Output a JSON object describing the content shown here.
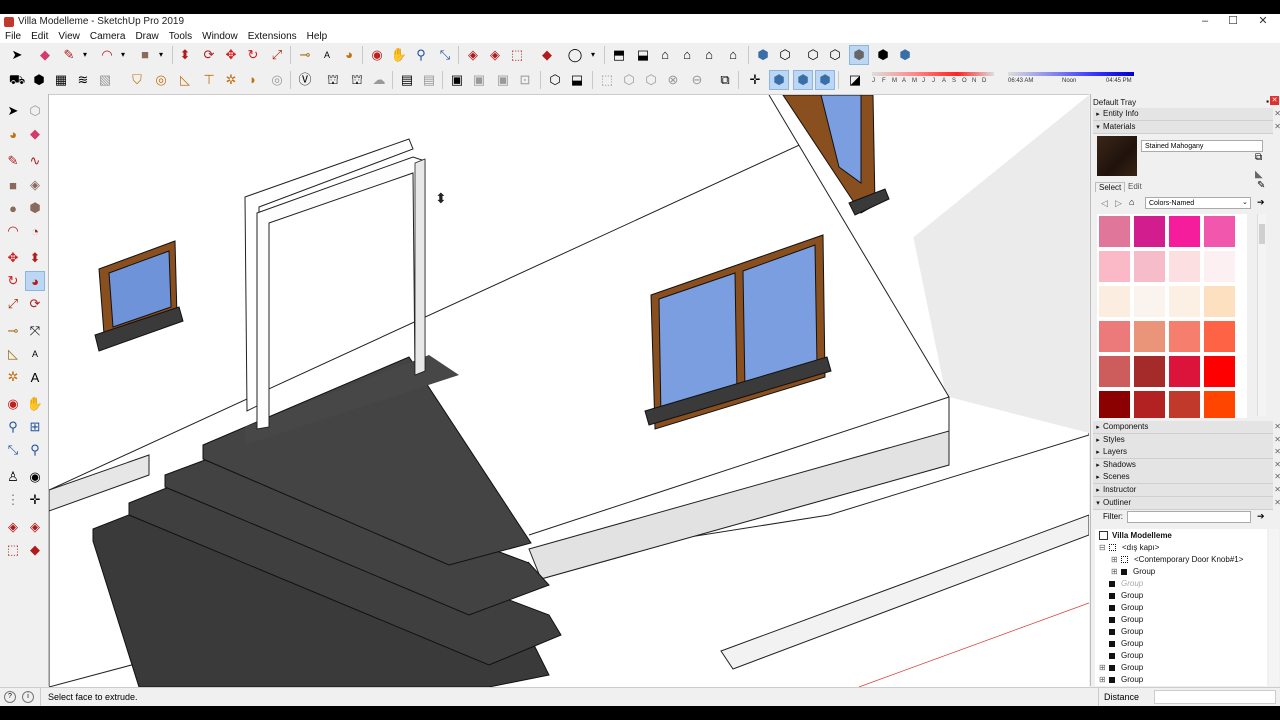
{
  "window": {
    "title": "Villa Modelleme - SketchUp Pro 2019",
    "controls": [
      "–",
      "☐",
      "✕"
    ]
  },
  "menu": [
    "File",
    "Edit",
    "View",
    "Camera",
    "Draw",
    "Tools",
    "Window",
    "Extensions",
    "Help"
  ],
  "shadow_settings": {
    "months": [
      "J",
      "F",
      "M",
      "A",
      "M",
      "J",
      "J",
      "A",
      "S",
      "O",
      "N",
      "D"
    ],
    "time_start": "06:43 AM",
    "time_noon": "Noon",
    "time_end": "04:45 PM"
  },
  "tray": {
    "title": "Default Tray",
    "entity_info": "Entity Info",
    "materials": "Materials",
    "material_name": "Stained Mahogany",
    "tab_select": "Select",
    "tab_edit": "Edit",
    "library": "Colors-Named",
    "swatches": [
      "#e0779b",
      "#d21d8e",
      "#f51d9c",
      "#f158ad",
      "#fbb8c7",
      "#f7bcca",
      "#fbdfe1",
      "#fcf0f3",
      "#fbeee0",
      "#fbf4ee",
      "#fcefe4",
      "#fce0c0",
      "#ec7a7a",
      "#ea957a",
      "#f57f6c",
      "#ff6346",
      "#cd5c5c",
      "#a52a2a",
      "#dc143c",
      "#ff0000",
      "#8b0000",
      "#b22222",
      "#c0392b",
      "#ff4500"
    ],
    "panels": [
      "Components",
      "Styles",
      "Layers",
      "Shadows",
      "Scenes",
      "Instructor"
    ],
    "outliner": {
      "title": "Outliner",
      "filter_label": "Filter:",
      "root": "Villa Modelleme",
      "items": [
        {
          "label": "<dış kapı>",
          "depth": 1,
          "expand": "⊟",
          "kind": "component"
        },
        {
          "label": "<Contemporary Door Knob#1>",
          "depth": 2,
          "expand": "⊞",
          "kind": "component"
        },
        {
          "label": "Group",
          "depth": 2,
          "expand": "⊞",
          "kind": "group"
        },
        {
          "label": "Group",
          "depth": 1,
          "expand": "",
          "kind": "hidden"
        },
        {
          "label": "Group",
          "depth": 1,
          "expand": "",
          "kind": "group"
        },
        {
          "label": "Group",
          "depth": 1,
          "expand": "",
          "kind": "group"
        },
        {
          "label": "Group",
          "depth": 1,
          "expand": "",
          "kind": "group"
        },
        {
          "label": "Group",
          "depth": 1,
          "expand": "",
          "kind": "group"
        },
        {
          "label": "Group",
          "depth": 1,
          "expand": "",
          "kind": "group"
        },
        {
          "label": "Group",
          "depth": 1,
          "expand": "",
          "kind": "group"
        },
        {
          "label": "Group",
          "depth": 1,
          "expand": "⊞",
          "kind": "group"
        },
        {
          "label": "Group",
          "depth": 1,
          "expand": "⊞",
          "kind": "group"
        },
        {
          "label": "Group",
          "depth": 1,
          "expand": "",
          "kind": "group"
        }
      ]
    }
  },
  "status": {
    "message": "Select face to extrude.",
    "measurement_label": "Distance"
  }
}
